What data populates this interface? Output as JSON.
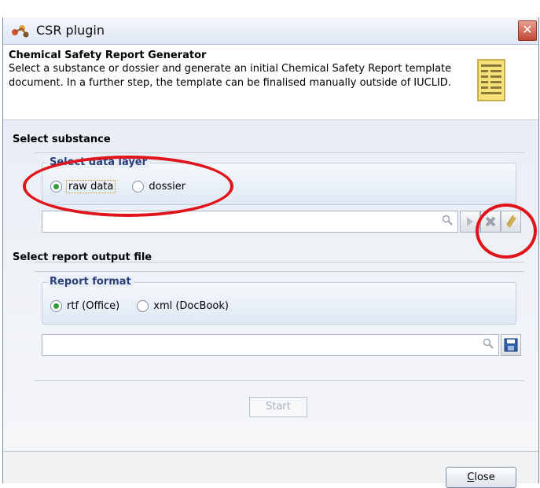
{
  "window": {
    "title": "CSR plugin",
    "close_glyph": "✕"
  },
  "header": {
    "title": "Chemical Safety Report Generator",
    "description": "Select a substance or dossier and generate an initial Chemical Safety Report template document. In a further step, the template can be finalised manually outside of IUCLID.",
    "icon": "document-list-icon"
  },
  "select_substance": {
    "title": "Select substance",
    "data_layer_group": "Select data layer",
    "options": [
      {
        "label": "raw data",
        "selected": true
      },
      {
        "label": "dossier",
        "selected": false
      }
    ],
    "search_value": "",
    "buttons": [
      "search-icon",
      "navigate-icon",
      "clear-icon",
      "attach-icon"
    ]
  },
  "select_output": {
    "title": "Select report output file",
    "format_group": "Report format",
    "options": [
      {
        "label": "rtf (Office)",
        "selected": true
      },
      {
        "label": "xml (DocBook)",
        "selected": false
      }
    ],
    "path_value": "",
    "buttons": [
      "search-icon",
      "save-icon"
    ]
  },
  "actions": {
    "start_label": "Start",
    "close_label_mnemonic": "C",
    "close_label_rest": "lose"
  },
  "colors": {
    "annotation_red": "#e0141a",
    "group_label_blue": "#2b3f78",
    "radio_green": "#2f9e3a"
  }
}
